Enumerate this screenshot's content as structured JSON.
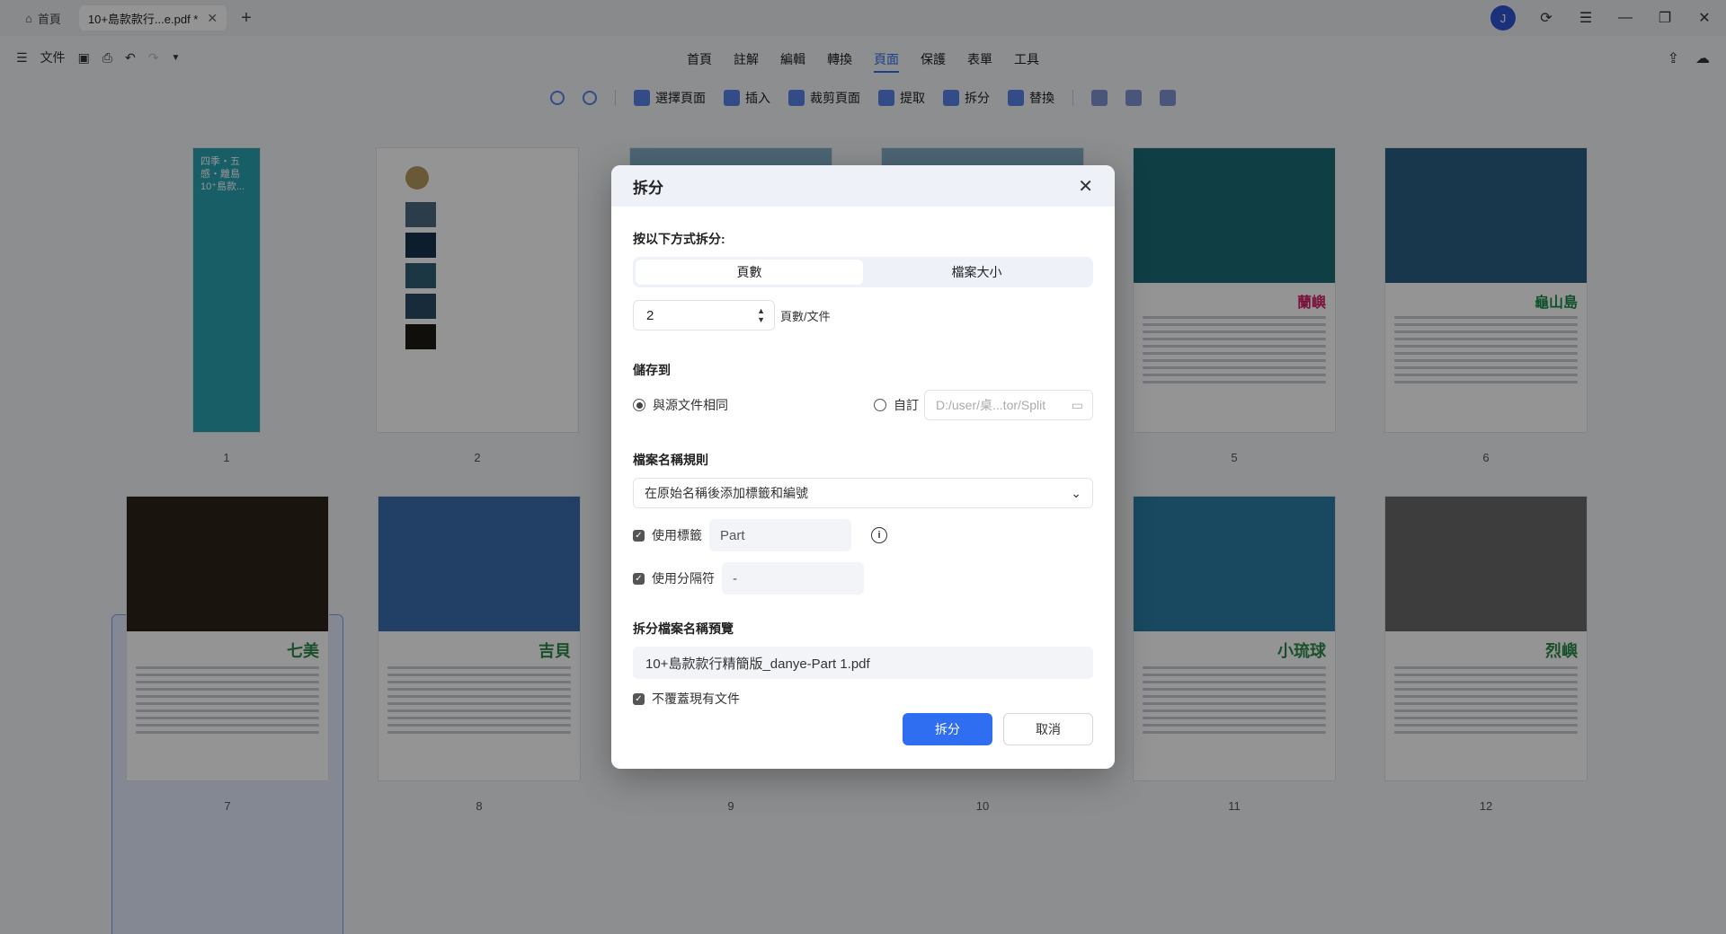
{
  "titlebar": {
    "home_tab": "首頁",
    "doc_tab": "10+島款款行...e.pdf *",
    "avatar_initial": "J"
  },
  "menubar": {
    "file": "文件",
    "items": [
      "首頁",
      "註解",
      "編輯",
      "轉換",
      "頁面",
      "保護",
      "表單",
      "工具"
    ],
    "active": "頁面"
  },
  "page_tools": {
    "select_pages": "選擇頁面",
    "insert": "插入",
    "crop": "裁剪頁面",
    "extract": "提取",
    "split": "拆分",
    "replace": "替換"
  },
  "pages": [
    {
      "num": "1",
      "title": "四季・五感・離島  10⁺島款..."
    },
    {
      "num": "2",
      "title": ""
    },
    {
      "num": "5",
      "title": "蘭嶼"
    },
    {
      "num": "6",
      "title": "龜山島"
    },
    {
      "num": "7",
      "title": "七美"
    },
    {
      "num": "8",
      "title": "吉貝"
    },
    {
      "num": "9",
      "title": ""
    },
    {
      "num": "10",
      "title": ""
    },
    {
      "num": "11",
      "title": "小琉球"
    },
    {
      "num": "12",
      "title": "烈嶼"
    }
  ],
  "dialog": {
    "title": "拆分",
    "split_by_label": "按以下方式拆分:",
    "mode_pages": "頁數",
    "mode_size": "檔案大小",
    "pages_value": "2",
    "pages_unit": "頁數/文件",
    "save_to_label": "儲存到",
    "same_as_source": "與源文件相同",
    "custom": "自訂",
    "custom_path_placeholder": "D:/user/桌...tor/Split",
    "naming_rule_label": "檔案名稱規則",
    "naming_rule_value": "在原始名稱後添加標籤和編號",
    "use_tag": "使用標籤",
    "tag_value": "Part",
    "use_separator": "使用分隔符",
    "separator_value": "-",
    "preview_label": "拆分檔案名稱預覽",
    "preview_value": "10+島款款行精簡版_danye-Part 1.pdf",
    "no_overwrite": "不覆蓋現有文件",
    "ok": "拆分",
    "cancel": "取消"
  },
  "colors": {
    "accent": "#2f6ef0",
    "avatar": "#2f55d4"
  }
}
